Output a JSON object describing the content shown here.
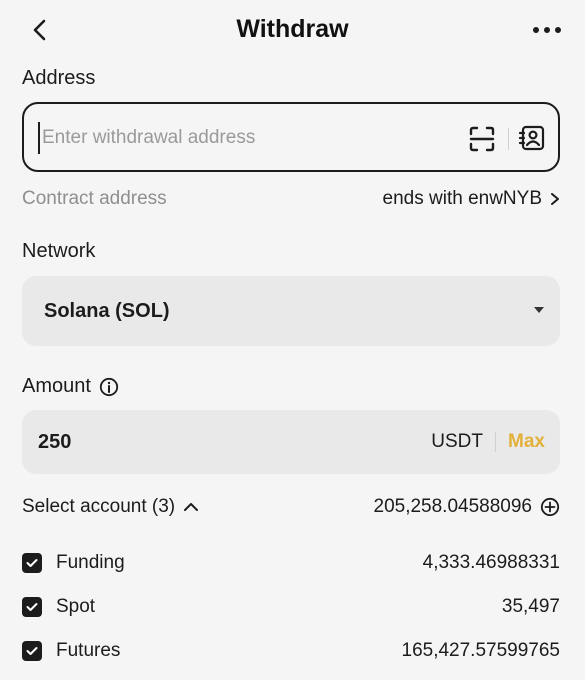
{
  "header": {
    "title": "Withdraw"
  },
  "address": {
    "label": "Address",
    "placeholder": "Enter withdrawal address",
    "value": ""
  },
  "contract": {
    "label": "Contract address",
    "value": "ends with enwNYB"
  },
  "network": {
    "label": "Network",
    "selected": "Solana (SOL)"
  },
  "amount": {
    "label": "Amount",
    "value": "250",
    "unit": "USDT",
    "max_label": "Max"
  },
  "select_account": {
    "label": "Select account (3)",
    "total": "205,258.04588096"
  },
  "accounts": [
    {
      "name": "Funding",
      "value": "4,333.46988331",
      "checked": true
    },
    {
      "name": "Spot",
      "value": "35,497",
      "checked": true
    },
    {
      "name": "Futures",
      "value": "165,427.57599765",
      "checked": true
    }
  ],
  "colors": {
    "accent": "#e3b13a",
    "text": "#1c1c1c",
    "muted": "#8f8f8f",
    "field_bg": "#e9e9e9"
  },
  "icons": {
    "back": "chevron-left-icon",
    "more": "more-horizontal-icon",
    "scan": "scan-icon",
    "contacts": "address-book-icon",
    "contract_arrow": "chevron-right-icon",
    "dropdown": "caret-down-icon",
    "info": "info-icon",
    "collapse": "chevron-up-icon",
    "add": "plus-circle-icon",
    "check": "check-icon"
  }
}
